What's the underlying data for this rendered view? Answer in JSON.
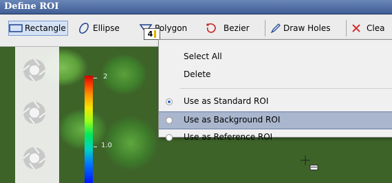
{
  "window": {
    "title": "Define ROI"
  },
  "toolbar": {
    "items": [
      {
        "label": "Rectangle",
        "icon": "rectangle-icon"
      },
      {
        "label": "Ellipse",
        "icon": "ellipse-icon"
      },
      {
        "label": "Polygon",
        "icon": "polygon-icon"
      },
      {
        "label": "Bezier",
        "icon": "bezier-icon"
      },
      {
        "label": "Draw Holes",
        "icon": "pencil-icon"
      },
      {
        "label": "Clea",
        "icon": "close-icon"
      }
    ]
  },
  "colorbar": {
    "ticks": [
      "2",
      "1.0"
    ]
  },
  "roi": {
    "label": "4"
  },
  "context_menu": {
    "items": [
      {
        "label": "Select All"
      },
      {
        "label": "Delete"
      },
      {
        "label": "Use as Standard ROI",
        "selected": true
      },
      {
        "label": "Use as Background ROI",
        "selected": false,
        "highlighted": true
      },
      {
        "label": "Use as Reference ROI",
        "selected": false
      }
    ]
  },
  "colors": {
    "accent": "#3f5e95",
    "highlight": "#a9b6cd"
  }
}
